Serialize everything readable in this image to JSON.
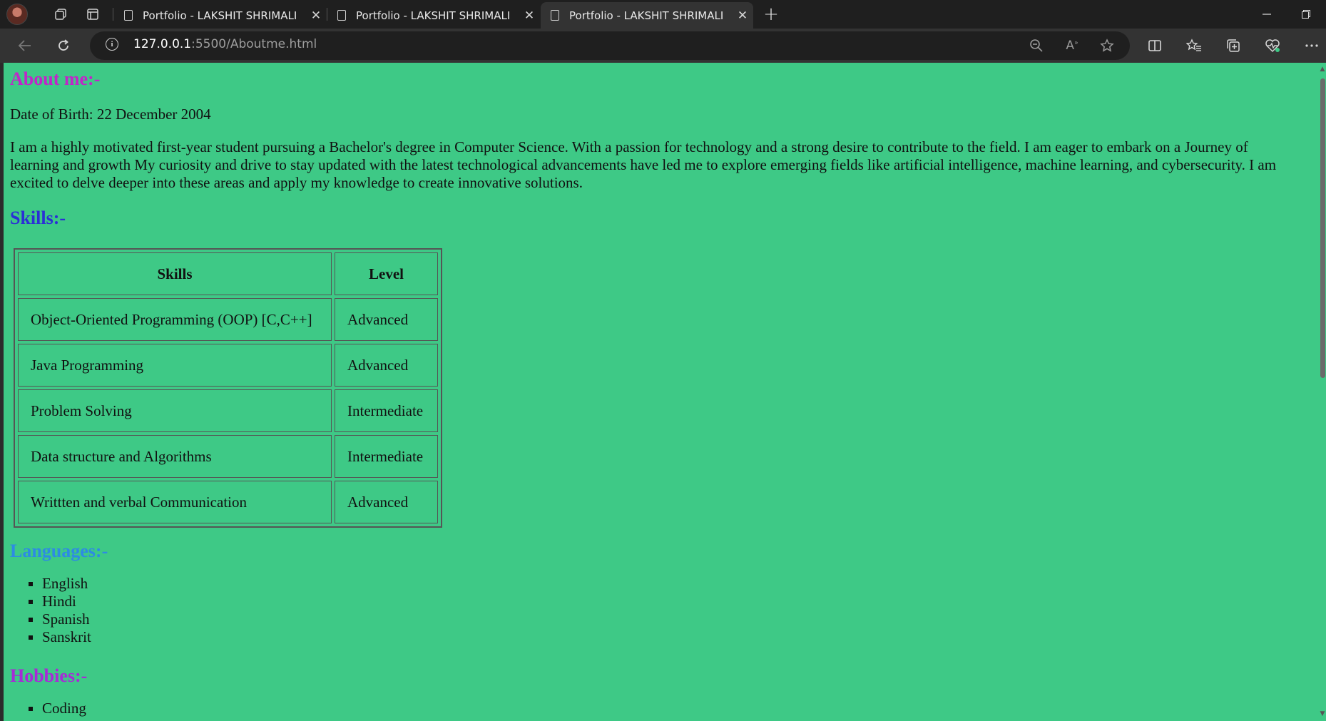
{
  "browser": {
    "tabs": [
      {
        "title": "Portfolio - LAKSHIT SHRIMALI",
        "active": false
      },
      {
        "title": "Portfolio - LAKSHIT SHRIMALI",
        "active": false
      },
      {
        "title": "Portfolio - LAKSHIT SHRIMALI",
        "active": true
      }
    ],
    "new_tab_label": "+",
    "url_host": "127.0.0.1",
    "url_rest": ":5500/Aboutme.html"
  },
  "page": {
    "about_heading": "About me:-",
    "dob": "Date of Birth: 22 December 2004",
    "intro": "I am a highly motivated first-year student pursuing a Bachelor's degree in Computer Science. With a passion for technology and a strong desire to contribute to the field. I am eager to embark on a Journey of learning and growth My curiosity and drive to stay updated with the latest technological advancements have led me to explore emerging fields like artificial intelligence, machine learning, and cybersecurity. I am excited to delve deeper into these areas and apply my knowledge to create innovative solutions.",
    "skills_heading": "Skills:-",
    "skills_table": {
      "headers": [
        "Skills",
        "Level"
      ],
      "rows": [
        [
          "Object-Oriented Programming (OOP) [C,C++]",
          "Advanced"
        ],
        [
          "Java Programming",
          "Advanced"
        ],
        [
          "Problem Solving",
          "Intermediate"
        ],
        [
          "Data structure and Algorithms",
          "Intermediate"
        ],
        [
          "Writtten and verbal Communication",
          "Advanced"
        ]
      ]
    },
    "languages_heading": "Languages:-",
    "languages": [
      "English",
      "Hindi",
      "Spanish",
      "Sanskrit"
    ],
    "hobbies_heading": "Hobbies:-",
    "hobbies": [
      "Coding"
    ]
  },
  "colors": {
    "page_background": "#3ec986",
    "about_heading": "#c026c9",
    "skills_heading": "#2b2fd6",
    "languages_heading": "#2d8be3",
    "hobbies_heading": "#a72bd6"
  }
}
